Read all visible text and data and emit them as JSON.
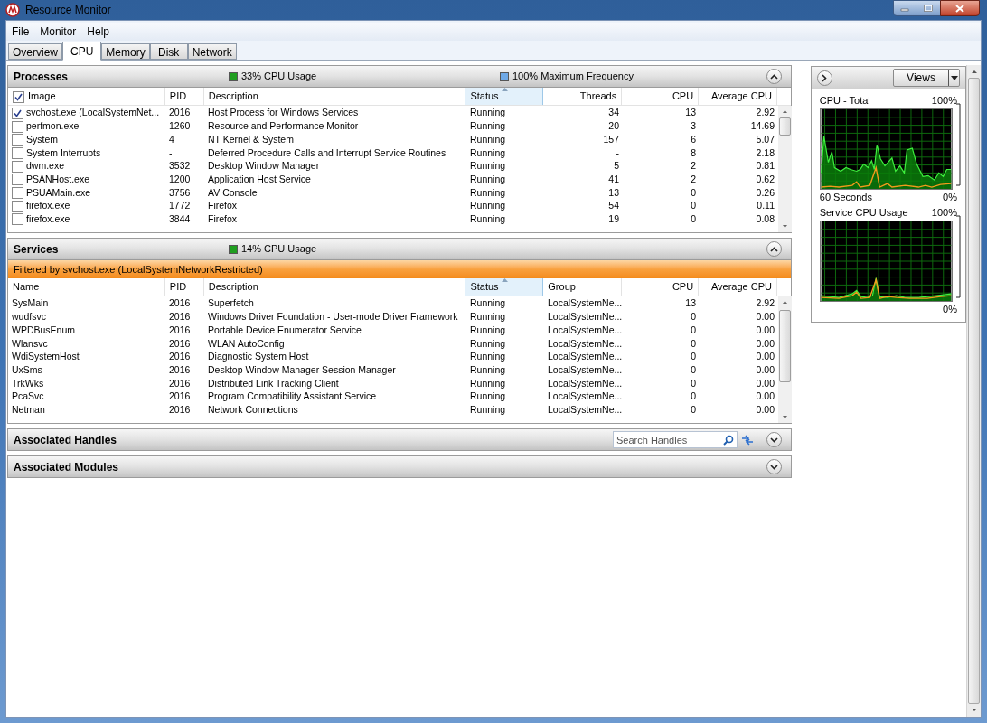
{
  "window": {
    "title": "Resource Monitor"
  },
  "menu": [
    "File",
    "Monitor",
    "Help"
  ],
  "tabs": [
    {
      "label": "Overview",
      "selected": false
    },
    {
      "label": "CPU",
      "selected": true
    },
    {
      "label": "Memory",
      "selected": false
    },
    {
      "label": "Disk",
      "selected": false
    },
    {
      "label": "Network",
      "selected": false
    }
  ],
  "processes": {
    "title": "Processes",
    "expanded": true,
    "header_checked": true,
    "legend": [
      {
        "label": "33% CPU Usage",
        "color": "#1f9e1f"
      },
      {
        "label": "100% Maximum Frequency",
        "color": "#6fa9e6"
      }
    ],
    "columns": [
      {
        "label": "Image",
        "numeric": false,
        "sorted": false
      },
      {
        "label": "PID",
        "numeric": false,
        "sorted": false
      },
      {
        "label": "Description",
        "numeric": false,
        "sorted": false
      },
      {
        "label": "Status",
        "numeric": false,
        "sorted": true
      },
      {
        "label": "Threads",
        "numeric": true,
        "sorted": false
      },
      {
        "label": "CPU",
        "numeric": true,
        "sorted": false
      },
      {
        "label": "Average CPU",
        "numeric": true,
        "sorted": false
      }
    ],
    "rows": [
      {
        "checked": true,
        "cells": [
          "svchost.exe (LocalSystemNet...",
          "2016",
          "Host Process for Windows Services",
          "Running",
          "34",
          "13",
          "2.92"
        ]
      },
      {
        "checked": false,
        "cells": [
          "perfmon.exe",
          "1260",
          "Resource and Performance Monitor",
          "Running",
          "20",
          "3",
          "14.69"
        ]
      },
      {
        "checked": false,
        "cells": [
          "System",
          "4",
          "NT Kernel & System",
          "Running",
          "157",
          "6",
          "5.07"
        ]
      },
      {
        "checked": false,
        "cells": [
          "System Interrupts",
          "-",
          "Deferred Procedure Calls and Interrupt Service Routines",
          "Running",
          "-",
          "8",
          "2.18"
        ]
      },
      {
        "checked": false,
        "cells": [
          "dwm.exe",
          "3532",
          "Desktop Window Manager",
          "Running",
          "5",
          "2",
          "0.81"
        ]
      },
      {
        "checked": false,
        "cells": [
          "PSANHost.exe",
          "1200",
          "Application Host Service",
          "Running",
          "41",
          "2",
          "0.62"
        ]
      },
      {
        "checked": false,
        "cells": [
          "PSUAMain.exe",
          "3756",
          "AV Console",
          "Running",
          "13",
          "0",
          "0.26"
        ]
      },
      {
        "checked": false,
        "cells": [
          "firefox.exe",
          "1772",
          "Firefox",
          "Running",
          "54",
          "0",
          "0.11"
        ]
      },
      {
        "checked": false,
        "cells": [
          "firefox.exe",
          "3844",
          "Firefox",
          "Running",
          "19",
          "0",
          "0.08"
        ]
      }
    ]
  },
  "services": {
    "title": "Services",
    "expanded": true,
    "legend": [
      {
        "label": "14% CPU Usage",
        "color": "#1f9e1f"
      }
    ],
    "filter": "Filtered by svchost.exe (LocalSystemNetworkRestricted)",
    "columns": [
      {
        "label": "Name",
        "numeric": false,
        "sorted": false
      },
      {
        "label": "PID",
        "numeric": false,
        "sorted": false
      },
      {
        "label": "Description",
        "numeric": false,
        "sorted": false
      },
      {
        "label": "Status",
        "numeric": false,
        "sorted": true
      },
      {
        "label": "Group",
        "numeric": false,
        "sorted": false
      },
      {
        "label": "CPU",
        "numeric": true,
        "sorted": false
      },
      {
        "label": "Average CPU",
        "numeric": true,
        "sorted": false
      }
    ],
    "rows": [
      {
        "cells": [
          "SysMain",
          "2016",
          "Superfetch",
          "Running",
          "LocalSystemNe...",
          "13",
          "2.92"
        ]
      },
      {
        "cells": [
          "wudfsvc",
          "2016",
          "Windows Driver Foundation - User-mode Driver Framework",
          "Running",
          "LocalSystemNe...",
          "0",
          "0.00"
        ]
      },
      {
        "cells": [
          "WPDBusEnum",
          "2016",
          "Portable Device Enumerator Service",
          "Running",
          "LocalSystemNe...",
          "0",
          "0.00"
        ]
      },
      {
        "cells": [
          "Wlansvc",
          "2016",
          "WLAN AutoConfig",
          "Running",
          "LocalSystemNe...",
          "0",
          "0.00"
        ]
      },
      {
        "cells": [
          "WdiSystemHost",
          "2016",
          "Diagnostic System Host",
          "Running",
          "LocalSystemNe...",
          "0",
          "0.00"
        ]
      },
      {
        "cells": [
          "UxSms",
          "2016",
          "Desktop Window Manager Session Manager",
          "Running",
          "LocalSystemNe...",
          "0",
          "0.00"
        ]
      },
      {
        "cells": [
          "TrkWks",
          "2016",
          "Distributed Link Tracking Client",
          "Running",
          "LocalSystemNe...",
          "0",
          "0.00"
        ]
      },
      {
        "cells": [
          "PcaSvc",
          "2016",
          "Program Compatibility Assistant Service",
          "Running",
          "LocalSystemNe...",
          "0",
          "0.00"
        ]
      },
      {
        "cells": [
          "Netman",
          "2016",
          "Network Connections",
          "Running",
          "LocalSystemNe...",
          "0",
          "0.00"
        ]
      }
    ]
  },
  "handles": {
    "title": "Associated Handles",
    "expanded": false,
    "search": {
      "placeholder": "Search Handles"
    }
  },
  "modules": {
    "title": "Associated Modules",
    "expanded": false
  },
  "graphs_panel": {
    "views": "Views",
    "graphs": [
      {
        "kind": "total",
        "title": "CPU - Total",
        "max": "100%",
        "time": "60 Seconds",
        "min": "0%"
      },
      {
        "kind": "service",
        "title": "Service CPU Usage",
        "max": "100%",
        "min": "0%"
      }
    ]
  }
}
